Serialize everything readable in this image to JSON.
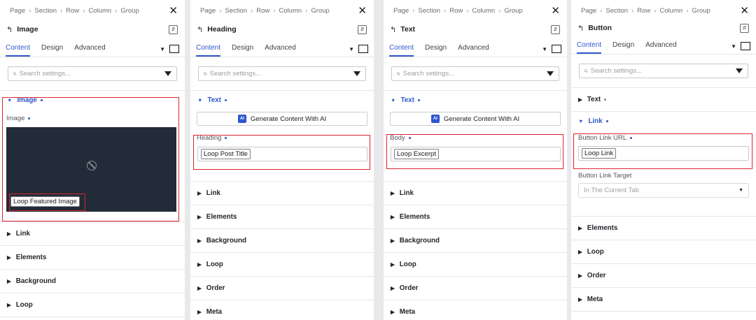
{
  "breadcrumb": [
    "Page",
    "Section",
    "Row",
    "Column",
    "Group"
  ],
  "tabs": [
    "Content",
    "Design",
    "Advanced"
  ],
  "search_placeholder": "Search settings...",
  "accent_color": "#2f56cc",
  "highlight_color": "#d9252e",
  "panels": [
    {
      "title": "Image",
      "open_group": "Image",
      "field_label": "Image",
      "dynamic_tag": "Loop Featured Image",
      "groups": [
        "Link",
        "Elements",
        "Background",
        "Loop"
      ]
    },
    {
      "title": "Heading",
      "open_group": "Text",
      "ai_button": "Generate Content With AI",
      "field_label": "Heading",
      "dynamic_tag": "Loop Post Title",
      "groups": [
        "Link",
        "Elements",
        "Background",
        "Loop",
        "Order",
        "Meta"
      ]
    },
    {
      "title": "Text",
      "open_group": "Text",
      "ai_button": "Generate Content With AI",
      "field_label": "Body",
      "dynamic_tag": "Loop Excerpt",
      "groups": [
        "Link",
        "Elements",
        "Background",
        "Loop",
        "Order",
        "Meta"
      ]
    },
    {
      "title": "Button",
      "collapsed_group": "Text",
      "open_group": "Link",
      "field_label": "Button Link URL",
      "dynamic_tag": "Loop Link",
      "target_label": "Button Link Target",
      "target_value": "In The Current Tab",
      "groups": [
        "Elements",
        "Loop",
        "Order",
        "Meta"
      ]
    }
  ]
}
